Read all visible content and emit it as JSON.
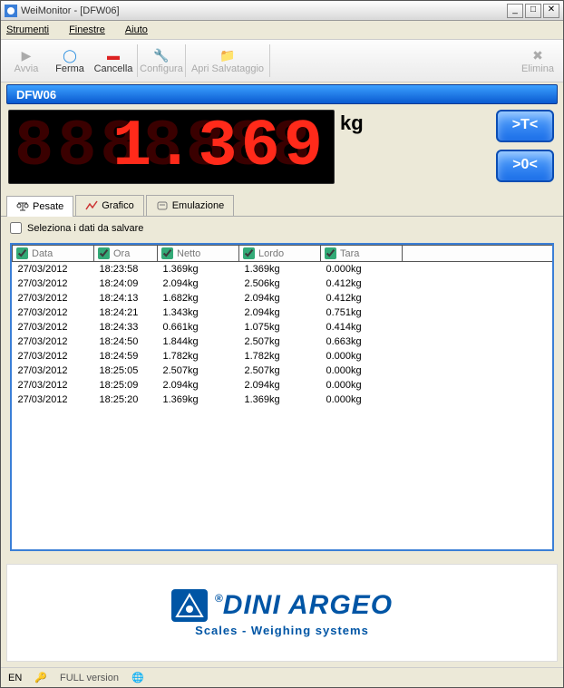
{
  "window": {
    "title": "WeiMonitor - [DFW06]"
  },
  "menubar": {
    "items": [
      "Strumenti",
      "Finestre",
      "Aiuto"
    ]
  },
  "toolbar": {
    "avvia": "Avvia",
    "ferma": "Ferma",
    "cancella": "Cancella",
    "configura": "Configura",
    "apri_salvataggio": "Apri Salvataggio",
    "elimina": "Elimina"
  },
  "header": {
    "title": "DFW06"
  },
  "display": {
    "value": "1.369",
    "bg": "8888888",
    "unit": "kg"
  },
  "buttons": {
    "tare": ">T<",
    "zero": ">0<"
  },
  "tabs": {
    "pesate": "Pesate",
    "grafico": "Grafico",
    "emulazione": "Emulazione"
  },
  "options": {
    "seleziona": "Seleziona i dati da salvare"
  },
  "columns": {
    "data": "Data",
    "ora": "Ora",
    "netto": "Netto",
    "lordo": "Lordo",
    "tara": "Tara"
  },
  "columns_checked": {
    "data": true,
    "ora": true,
    "netto": true,
    "lordo": true,
    "tara": true
  },
  "rows": [
    {
      "data": "27/03/2012",
      "ora": "18:23:58",
      "netto": "1.369kg",
      "lordo": "1.369kg",
      "tara": "0.000kg"
    },
    {
      "data": "27/03/2012",
      "ora": "18:24:09",
      "netto": "2.094kg",
      "lordo": "2.506kg",
      "tara": "0.412kg"
    },
    {
      "data": "27/03/2012",
      "ora": "18:24:13",
      "netto": "1.682kg",
      "lordo": "2.094kg",
      "tara": "0.412kg"
    },
    {
      "data": "27/03/2012",
      "ora": "18:24:21",
      "netto": "1.343kg",
      "lordo": "2.094kg",
      "tara": "0.751kg"
    },
    {
      "data": "27/03/2012",
      "ora": "18:24:33",
      "netto": "0.661kg",
      "lordo": "1.075kg",
      "tara": "0.414kg"
    },
    {
      "data": "27/03/2012",
      "ora": "18:24:50",
      "netto": "1.844kg",
      "lordo": "2.507kg",
      "tara": "0.663kg"
    },
    {
      "data": "27/03/2012",
      "ora": "18:24:59",
      "netto": "1.782kg",
      "lordo": "1.782kg",
      "tara": "0.000kg"
    },
    {
      "data": "27/03/2012",
      "ora": "18:25:05",
      "netto": "2.507kg",
      "lordo": "2.507kg",
      "tara": "0.000kg"
    },
    {
      "data": "27/03/2012",
      "ora": "18:25:09",
      "netto": "2.094kg",
      "lordo": "2.094kg",
      "tara": "0.000kg"
    },
    {
      "data": "27/03/2012",
      "ora": "18:25:20",
      "netto": "1.369kg",
      "lordo": "1.369kg",
      "tara": "0.000kg"
    }
  ],
  "logo": {
    "name": "DINI ARGEO",
    "tagline": "Scales - Weighing systems",
    "reg": "®"
  },
  "status": {
    "lang": "EN",
    "version": "FULL version"
  }
}
